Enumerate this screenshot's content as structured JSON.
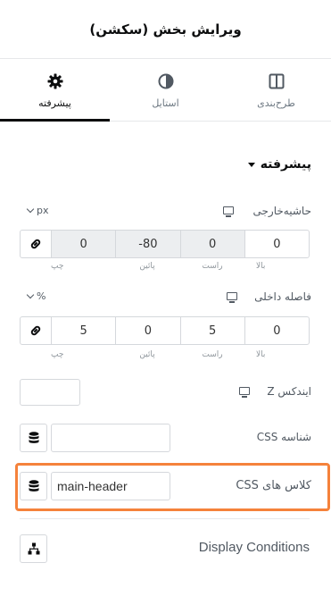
{
  "header": {
    "title": "ویرایش بخش (سکشن)"
  },
  "tabs": [
    {
      "label": "طرح‌بندی",
      "icon": "columns-icon"
    },
    {
      "label": "استایل",
      "icon": "half-circle-icon"
    },
    {
      "label": "پیشرفته",
      "icon": "gear-icon"
    }
  ],
  "section": {
    "title": "پیشرفته"
  },
  "margin": {
    "label": "حاشیه‌خارجی",
    "unit": "px",
    "values": {
      "top": "0",
      "right": "0",
      "bottom": "-80",
      "left": "0"
    },
    "sublabels": {
      "top": "بالا",
      "right": "راست",
      "bottom": "پائین",
      "left": "چپ"
    }
  },
  "padding": {
    "label": "فاصله داخلی",
    "unit": "%",
    "values": {
      "top": "0",
      "right": "5",
      "bottom": "0",
      "left": "5"
    },
    "sublabels": {
      "top": "بالا",
      "right": "راست",
      "bottom": "پائین",
      "left": "چپ"
    }
  },
  "zindex": {
    "label": "ایندکس Z",
    "value": ""
  },
  "css_id": {
    "label": "شناسه CSS",
    "value": ""
  },
  "css_classes": {
    "label": "کلاس های CSS",
    "value": "main-header"
  },
  "display_conditions": {
    "label": "Display Conditions"
  },
  "colors": {
    "highlight": "#f5823b",
    "active_tab": "#0c0d0e",
    "border": "#d5d8dc"
  }
}
